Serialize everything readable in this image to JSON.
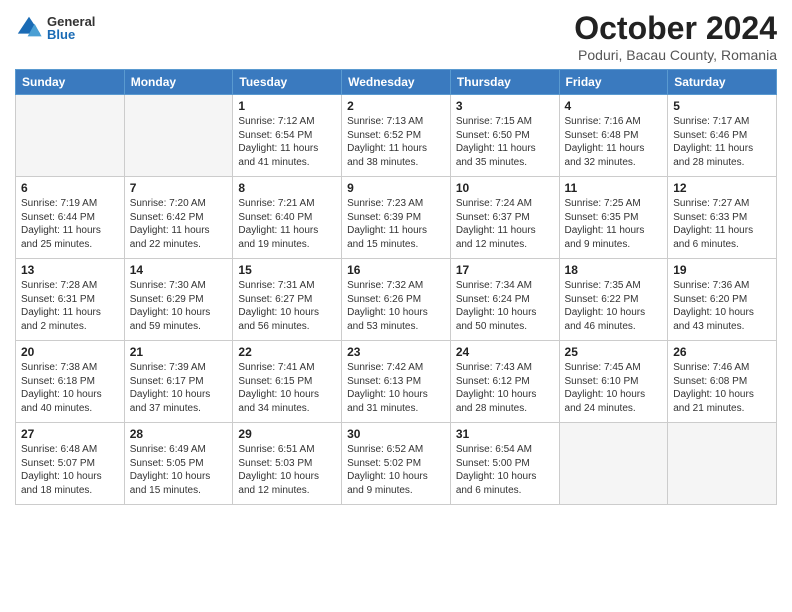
{
  "logo": {
    "general": "General",
    "blue": "Blue"
  },
  "title": "October 2024",
  "subtitle": "Poduri, Bacau County, Romania",
  "days_of_week": [
    "Sunday",
    "Monday",
    "Tuesday",
    "Wednesday",
    "Thursday",
    "Friday",
    "Saturday"
  ],
  "weeks": [
    [
      {
        "day": "",
        "info": ""
      },
      {
        "day": "",
        "info": ""
      },
      {
        "day": "1",
        "info": "Sunrise: 7:12 AM\nSunset: 6:54 PM\nDaylight: 11 hours and 41 minutes."
      },
      {
        "day": "2",
        "info": "Sunrise: 7:13 AM\nSunset: 6:52 PM\nDaylight: 11 hours and 38 minutes."
      },
      {
        "day": "3",
        "info": "Sunrise: 7:15 AM\nSunset: 6:50 PM\nDaylight: 11 hours and 35 minutes."
      },
      {
        "day": "4",
        "info": "Sunrise: 7:16 AM\nSunset: 6:48 PM\nDaylight: 11 hours and 32 minutes."
      },
      {
        "day": "5",
        "info": "Sunrise: 7:17 AM\nSunset: 6:46 PM\nDaylight: 11 hours and 28 minutes."
      }
    ],
    [
      {
        "day": "6",
        "info": "Sunrise: 7:19 AM\nSunset: 6:44 PM\nDaylight: 11 hours and 25 minutes."
      },
      {
        "day": "7",
        "info": "Sunrise: 7:20 AM\nSunset: 6:42 PM\nDaylight: 11 hours and 22 minutes."
      },
      {
        "day": "8",
        "info": "Sunrise: 7:21 AM\nSunset: 6:40 PM\nDaylight: 11 hours and 19 minutes."
      },
      {
        "day": "9",
        "info": "Sunrise: 7:23 AM\nSunset: 6:39 PM\nDaylight: 11 hours and 15 minutes."
      },
      {
        "day": "10",
        "info": "Sunrise: 7:24 AM\nSunset: 6:37 PM\nDaylight: 11 hours and 12 minutes."
      },
      {
        "day": "11",
        "info": "Sunrise: 7:25 AM\nSunset: 6:35 PM\nDaylight: 11 hours and 9 minutes."
      },
      {
        "day": "12",
        "info": "Sunrise: 7:27 AM\nSunset: 6:33 PM\nDaylight: 11 hours and 6 minutes."
      }
    ],
    [
      {
        "day": "13",
        "info": "Sunrise: 7:28 AM\nSunset: 6:31 PM\nDaylight: 11 hours and 2 minutes."
      },
      {
        "day": "14",
        "info": "Sunrise: 7:30 AM\nSunset: 6:29 PM\nDaylight: 10 hours and 59 minutes."
      },
      {
        "day": "15",
        "info": "Sunrise: 7:31 AM\nSunset: 6:27 PM\nDaylight: 10 hours and 56 minutes."
      },
      {
        "day": "16",
        "info": "Sunrise: 7:32 AM\nSunset: 6:26 PM\nDaylight: 10 hours and 53 minutes."
      },
      {
        "day": "17",
        "info": "Sunrise: 7:34 AM\nSunset: 6:24 PM\nDaylight: 10 hours and 50 minutes."
      },
      {
        "day": "18",
        "info": "Sunrise: 7:35 AM\nSunset: 6:22 PM\nDaylight: 10 hours and 46 minutes."
      },
      {
        "day": "19",
        "info": "Sunrise: 7:36 AM\nSunset: 6:20 PM\nDaylight: 10 hours and 43 minutes."
      }
    ],
    [
      {
        "day": "20",
        "info": "Sunrise: 7:38 AM\nSunset: 6:18 PM\nDaylight: 10 hours and 40 minutes."
      },
      {
        "day": "21",
        "info": "Sunrise: 7:39 AM\nSunset: 6:17 PM\nDaylight: 10 hours and 37 minutes."
      },
      {
        "day": "22",
        "info": "Sunrise: 7:41 AM\nSunset: 6:15 PM\nDaylight: 10 hours and 34 minutes."
      },
      {
        "day": "23",
        "info": "Sunrise: 7:42 AM\nSunset: 6:13 PM\nDaylight: 10 hours and 31 minutes."
      },
      {
        "day": "24",
        "info": "Sunrise: 7:43 AM\nSunset: 6:12 PM\nDaylight: 10 hours and 28 minutes."
      },
      {
        "day": "25",
        "info": "Sunrise: 7:45 AM\nSunset: 6:10 PM\nDaylight: 10 hours and 24 minutes."
      },
      {
        "day": "26",
        "info": "Sunrise: 7:46 AM\nSunset: 6:08 PM\nDaylight: 10 hours and 21 minutes."
      }
    ],
    [
      {
        "day": "27",
        "info": "Sunrise: 6:48 AM\nSunset: 5:07 PM\nDaylight: 10 hours and 18 minutes."
      },
      {
        "day": "28",
        "info": "Sunrise: 6:49 AM\nSunset: 5:05 PM\nDaylight: 10 hours and 15 minutes."
      },
      {
        "day": "29",
        "info": "Sunrise: 6:51 AM\nSunset: 5:03 PM\nDaylight: 10 hours and 12 minutes."
      },
      {
        "day": "30",
        "info": "Sunrise: 6:52 AM\nSunset: 5:02 PM\nDaylight: 10 hours and 9 minutes."
      },
      {
        "day": "31",
        "info": "Sunrise: 6:54 AM\nSunset: 5:00 PM\nDaylight: 10 hours and 6 minutes."
      },
      {
        "day": "",
        "info": ""
      },
      {
        "day": "",
        "info": ""
      }
    ]
  ]
}
